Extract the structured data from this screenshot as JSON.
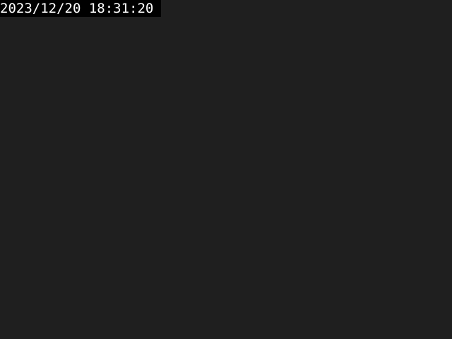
{
  "overlay": {
    "timestamp": "2023/12/20 18:31:20",
    "text_color": "#ffffff",
    "background_color": "#000000"
  },
  "video": {
    "background_color": "#1f1f1f"
  }
}
